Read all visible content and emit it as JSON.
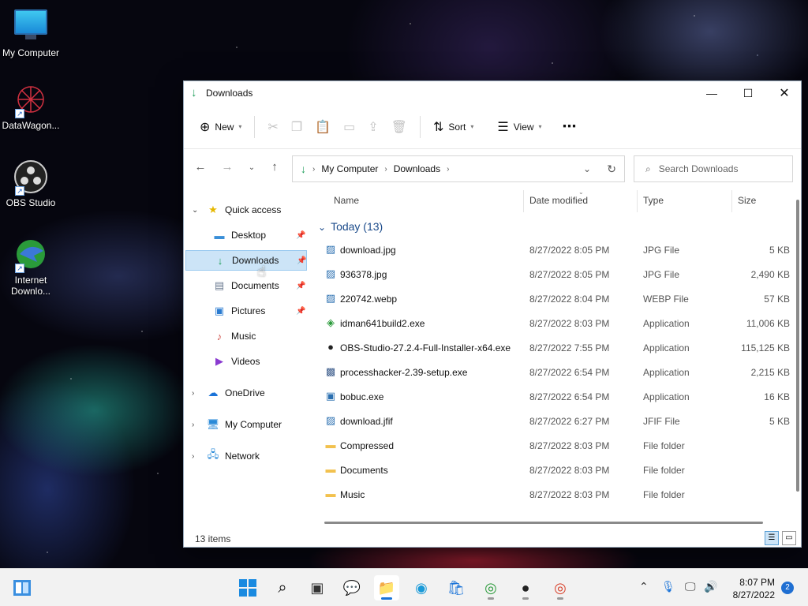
{
  "desktop": {
    "icons": [
      {
        "label": "My Computer",
        "icon": "computer-icon"
      },
      {
        "label": "DataWagon...",
        "icon": "datawagon-icon"
      },
      {
        "label": "OBS Studio",
        "icon": "obs-icon"
      },
      {
        "label": "Internet\nDownlo...",
        "icon": "internet-download-manager-icon"
      }
    ]
  },
  "window": {
    "title": "Downloads",
    "toolbar": {
      "new_label": "New",
      "sort_label": "Sort",
      "view_label": "View"
    },
    "address": {
      "crumbs": [
        "My Computer",
        "Downloads"
      ]
    },
    "search": {
      "placeholder": "Search Downloads"
    },
    "sidebar": {
      "quick_access": "Quick access",
      "items": [
        {
          "label": "Desktop",
          "pinned": true
        },
        {
          "label": "Downloads",
          "pinned": true,
          "selected": true
        },
        {
          "label": "Documents",
          "pinned": true
        },
        {
          "label": "Pictures",
          "pinned": true
        },
        {
          "label": "Music",
          "pinned": false
        },
        {
          "label": "Videos",
          "pinned": false
        }
      ],
      "onedrive": "OneDrive",
      "my_computer": "My Computer",
      "network": "Network"
    },
    "columns": {
      "name": "Name",
      "date": "Date modified",
      "type": "Type",
      "size": "Size"
    },
    "group_label": "Today (13)",
    "files": [
      {
        "name": "download.jpg",
        "date": "8/27/2022 8:05 PM",
        "type": "JPG File",
        "size": "5 KB",
        "icon": "image-file-icon"
      },
      {
        "name": "936378.jpg",
        "date": "8/27/2022 8:05 PM",
        "type": "JPG File",
        "size": "2,490 KB",
        "icon": "image-file-icon"
      },
      {
        "name": "220742.webp",
        "date": "8/27/2022 8:04 PM",
        "type": "WEBP File",
        "size": "57 KB",
        "icon": "image-file-icon"
      },
      {
        "name": "idman641build2.exe",
        "date": "8/27/2022 8:03 PM",
        "type": "Application",
        "size": "11,006 KB",
        "icon": "idm-installer-icon"
      },
      {
        "name": "OBS-Studio-27.2.4-Full-Installer-x64.exe",
        "date": "8/27/2022 7:55 PM",
        "type": "Application",
        "size": "115,125 KB",
        "icon": "obs-installer-icon"
      },
      {
        "name": "processhacker-2.39-setup.exe",
        "date": "8/27/2022 6:54 PM",
        "type": "Application",
        "size": "2,215 KB",
        "icon": "processhacker-installer-icon"
      },
      {
        "name": "bobuc.exe",
        "date": "8/27/2022 6:54 PM",
        "type": "Application",
        "size": "16 KB",
        "icon": "application-icon"
      },
      {
        "name": "download.jfif",
        "date": "8/27/2022 6:27 PM",
        "type": "JFIF File",
        "size": "5 KB",
        "icon": "image-file-icon"
      },
      {
        "name": "Compressed",
        "date": "8/27/2022 8:03 PM",
        "type": "File folder",
        "size": "",
        "icon": "folder-icon"
      },
      {
        "name": "Documents",
        "date": "8/27/2022 8:03 PM",
        "type": "File folder",
        "size": "",
        "icon": "folder-icon"
      },
      {
        "name": "Music",
        "date": "8/27/2022 8:03 PM",
        "type": "File folder",
        "size": "",
        "icon": "folder-icon"
      }
    ],
    "status": "13 items"
  },
  "taskbar": {
    "time": "8:07 PM",
    "date": "8/27/2022",
    "notifications": "2"
  },
  "colors": {
    "accent": "#1e9e5a",
    "selection": "#cce4f7",
    "folder": "#f2c14e"
  }
}
